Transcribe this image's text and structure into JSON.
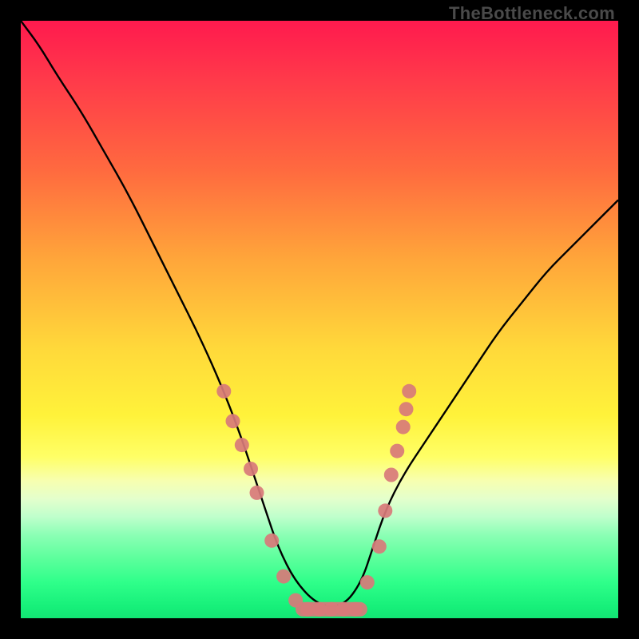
{
  "watermark": "TheBottleneck.com",
  "colors": {
    "curve_stroke": "#000000",
    "marker_fill": "#d87a7a",
    "marker_stroke": "#d87a7a",
    "bg_black": "#000000"
  },
  "chart_data": {
    "type": "line",
    "title": "",
    "xlabel": "",
    "ylabel": "",
    "xlim": [
      0,
      100
    ],
    "ylim": [
      0,
      100
    ],
    "grid": false,
    "note": "No axis ticks or numeric labels are rendered in the image. x/y values are normalized to the plot area (0–100). The curve is a V-shaped profile with a flat bottom; values are estimated from pixel positions.",
    "series": [
      {
        "name": "bottleneck-curve",
        "x": [
          0,
          3,
          6,
          10,
          14,
          18,
          22,
          26,
          30,
          34,
          37,
          39,
          41,
          43,
          46,
          50,
          54,
          57,
          59,
          61,
          64,
          68,
          72,
          76,
          80,
          84,
          88,
          92,
          96,
          100
        ],
        "y": [
          100,
          96,
          91,
          85,
          78,
          71,
          63,
          55,
          47,
          38,
          30,
          24,
          18,
          12,
          6,
          2,
          2,
          6,
          12,
          18,
          24,
          30,
          36,
          42,
          48,
          53,
          58,
          62,
          66,
          70
        ]
      }
    ],
    "markers": [
      {
        "name": "left-cluster",
        "points": [
          {
            "x": 34,
            "y": 38
          },
          {
            "x": 35.5,
            "y": 33
          },
          {
            "x": 37,
            "y": 29
          },
          {
            "x": 38.5,
            "y": 25
          },
          {
            "x": 39.5,
            "y": 21
          },
          {
            "x": 42,
            "y": 13
          },
          {
            "x": 44,
            "y": 7
          },
          {
            "x": 46,
            "y": 3
          }
        ]
      },
      {
        "name": "bottom-flat",
        "points": [
          {
            "x": 48,
            "y": 1.5
          },
          {
            "x": 50,
            "y": 1.5
          },
          {
            "x": 52,
            "y": 1.5
          },
          {
            "x": 54,
            "y": 1.5
          },
          {
            "x": 56,
            "y": 1.5
          }
        ]
      },
      {
        "name": "right-cluster",
        "points": [
          {
            "x": 58,
            "y": 6
          },
          {
            "x": 60,
            "y": 12
          },
          {
            "x": 61,
            "y": 18
          },
          {
            "x": 62,
            "y": 24
          },
          {
            "x": 63,
            "y": 28
          },
          {
            "x": 64,
            "y": 32
          },
          {
            "x": 64.5,
            "y": 35
          },
          {
            "x": 65,
            "y": 38
          }
        ]
      }
    ]
  }
}
